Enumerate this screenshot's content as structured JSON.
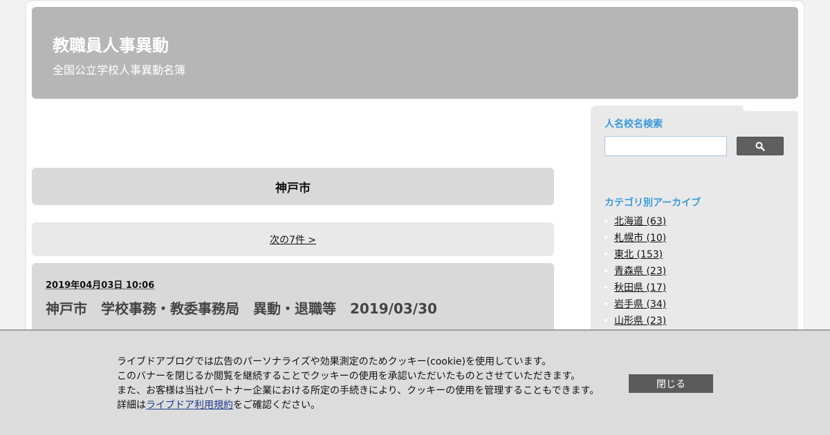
{
  "header": {
    "title": "教職員人事異動",
    "subtitle": "全国公立学校人事異動名簿"
  },
  "category": {
    "title": "神戸市"
  },
  "pagination": {
    "next_label": "次の7件 >"
  },
  "article": {
    "date": "2019年04月03日 10:06",
    "title": "神戸市　学校事務・教委事務局　異動・退職等　2019/03/30"
  },
  "sidebar": {
    "search_heading": "人名校名検索",
    "search_value": "",
    "search_button_icon": "search-icon",
    "archive_heading": "カテゴリ別アーカイブ",
    "archive_items": [
      {
        "label": "北海道 (63)"
      },
      {
        "label": "札幌市 (10)"
      },
      {
        "label": "東北 (153)"
      },
      {
        "label": "青森県 (23)"
      },
      {
        "label": "秋田県 (17)"
      },
      {
        "label": "岩手県 (34)"
      },
      {
        "label": "山形県 (23)"
      }
    ]
  },
  "cookie_banner": {
    "line1": "ライブドアブログでは広告のパーソナライズや効果測定のためクッキー(cookie)を使用しています。",
    "line2": "このバナーを閉じるか閲覧を継続することでクッキーの使用を承認いただいたものとさせていただきます。",
    "line3": "また、お客様は当社パートナー企業における所定の手続きにより、クッキーの使用を管理することもできます。",
    "line4_prefix": "詳細は",
    "line4_link": "ライブドア利用規約",
    "line4_suffix": "をご確認ください。",
    "close_label": "閉じる"
  },
  "colors": {
    "header_bg": "#b6b6b6",
    "sidebar_heading": "#3a9ad9",
    "button_bg": "#5b5b5b"
  }
}
